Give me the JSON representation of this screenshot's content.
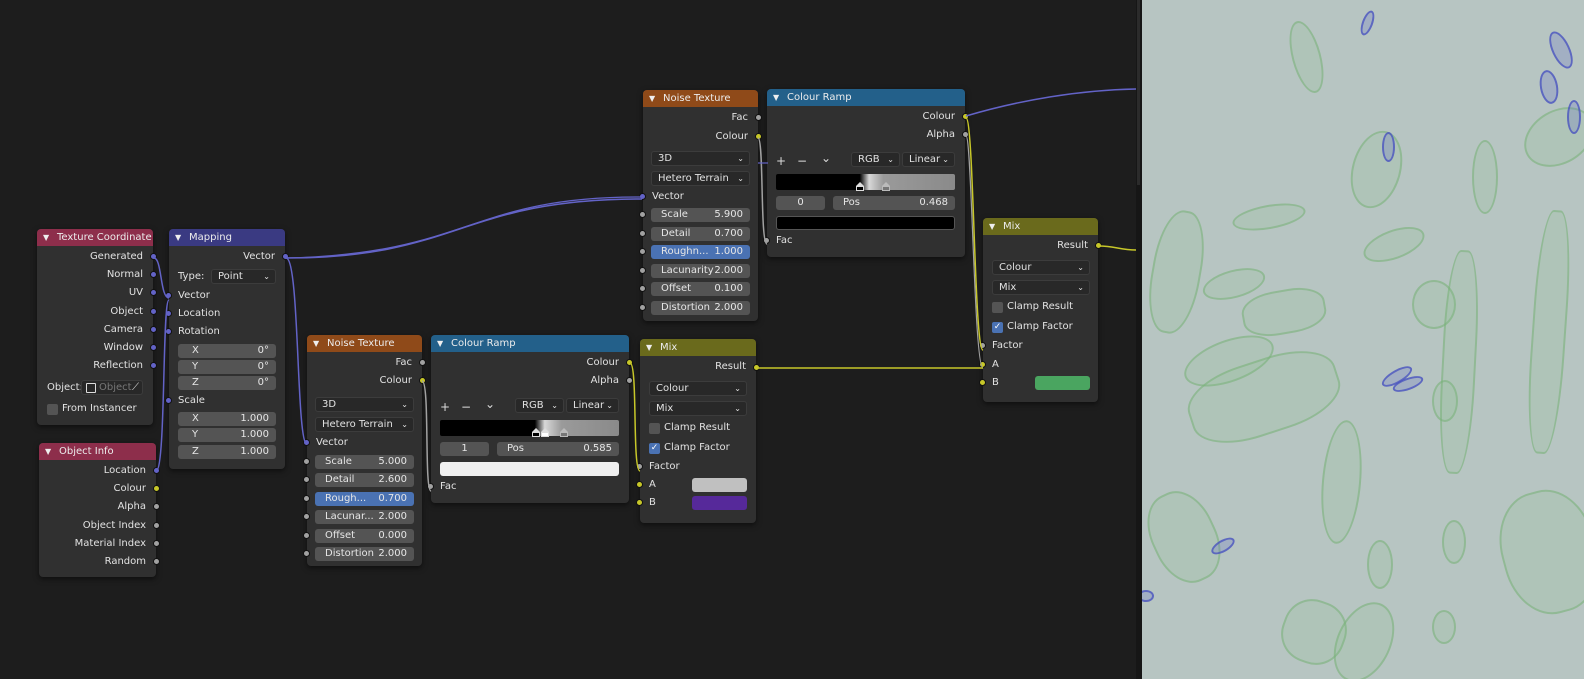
{
  "colors": {
    "editor_bg": "#1d1d1d",
    "node_bg": "#303030",
    "input_header": "#8d2e4b",
    "vector_header": "#3a3a82",
    "texture_header": "#8f4a19",
    "converter_header": "#23608a",
    "mix_header": "#6a6a1c",
    "socket_vector": "#6363c7",
    "socket_colour": "#c7c729",
    "socket_float": "#a1a1a1",
    "viewport_bg": "#b7c5c2"
  },
  "texture_coordinate": {
    "title": "Texture Coordinate",
    "outputs": [
      "Generated",
      "Normal",
      "UV",
      "Object",
      "Camera",
      "Window",
      "Reflection"
    ],
    "object_label": "Object:",
    "object_placeholder": "Object",
    "from_instancer": "From Instancer"
  },
  "object_info": {
    "title": "Object Info",
    "outputs": [
      "Location",
      "Colour",
      "Alpha",
      "Object Index",
      "Material Index",
      "Random"
    ]
  },
  "mapping": {
    "title": "Mapping",
    "output": "Vector",
    "type_label": "Type:",
    "type_value": "Point",
    "inputs": [
      "Vector",
      "Location",
      "Rotation",
      "Scale"
    ],
    "rotation": [
      {
        "axis": "X",
        "value": "0°"
      },
      {
        "axis": "Y",
        "value": "0°"
      },
      {
        "axis": "Z",
        "value": "0°"
      }
    ],
    "scale": [
      {
        "axis": "X",
        "value": "1.000"
      },
      {
        "axis": "Y",
        "value": "1.000"
      },
      {
        "axis": "Z",
        "value": "1.000"
      }
    ]
  },
  "noise_top": {
    "title": "Noise Texture",
    "outputs": [
      "Fac",
      "Colour"
    ],
    "dimensions": "3D",
    "type": "Hetero Terrain",
    "vector_label": "Vector",
    "fields": [
      {
        "label": "Scale",
        "value": "5.900"
      },
      {
        "label": "Detail",
        "value": "0.700"
      },
      {
        "label": "Roughn...",
        "value": "1.000"
      },
      {
        "label": "Lacunarity",
        "value": "2.000"
      },
      {
        "label": "Offset",
        "value": "0.100"
      },
      {
        "label": "Distortion",
        "value": "2.000"
      }
    ]
  },
  "ramp_top": {
    "title": "Colour Ramp",
    "outputs": [
      "Colour",
      "Alpha"
    ],
    "add": "+",
    "remove": "−",
    "menu": "⌄",
    "color_mode": "RGB",
    "interpolation": "Linear",
    "index": "0",
    "pos_label": "Pos",
    "pos_value": "0.468",
    "fac_label": "Fac",
    "stop_color": "#000000"
  },
  "mix_top": {
    "title": "Mix",
    "output": "Result",
    "data_type": "Colour",
    "blend": "Mix",
    "clamp_result": "Clamp Result",
    "clamp_factor": "Clamp Factor",
    "clamp_result_checked": false,
    "clamp_factor_checked": true,
    "inputs": [
      "Factor",
      "A",
      "B"
    ],
    "b_color": "#4aa560"
  },
  "noise_bottom": {
    "title": "Noise Texture",
    "outputs": [
      "Fac",
      "Colour"
    ],
    "dimensions": "3D",
    "type": "Hetero Terrain",
    "vector_label": "Vector",
    "fields": [
      {
        "label": "Scale",
        "value": "5.000"
      },
      {
        "label": "Detail",
        "value": "2.600"
      },
      {
        "label": "Rough...",
        "value": "0.700"
      },
      {
        "label": "Lacunar...",
        "value": "2.000"
      },
      {
        "label": "Offset",
        "value": "0.000"
      },
      {
        "label": "Distortion",
        "value": "2.000"
      }
    ]
  },
  "ramp_bottom": {
    "title": "Colour Ramp",
    "outputs": [
      "Colour",
      "Alpha"
    ],
    "add": "+",
    "remove": "−",
    "menu": "⌄",
    "color_mode": "RGB",
    "interpolation": "Linear",
    "index": "1",
    "pos_label": "Pos",
    "pos_value": "0.585",
    "fac_label": "Fac",
    "stop_color": "#f0f0f0"
  },
  "mix_bottom": {
    "title": "Mix",
    "output": "Result",
    "data_type": "Colour",
    "blend": "Mix",
    "clamp_result": "Clamp Result",
    "clamp_factor": "Clamp Factor",
    "clamp_result_checked": false,
    "clamp_factor_checked": true,
    "inputs": [
      "Factor",
      "A",
      "B"
    ],
    "a_color": "#c0c0c0",
    "b_color": "#56299a"
  }
}
